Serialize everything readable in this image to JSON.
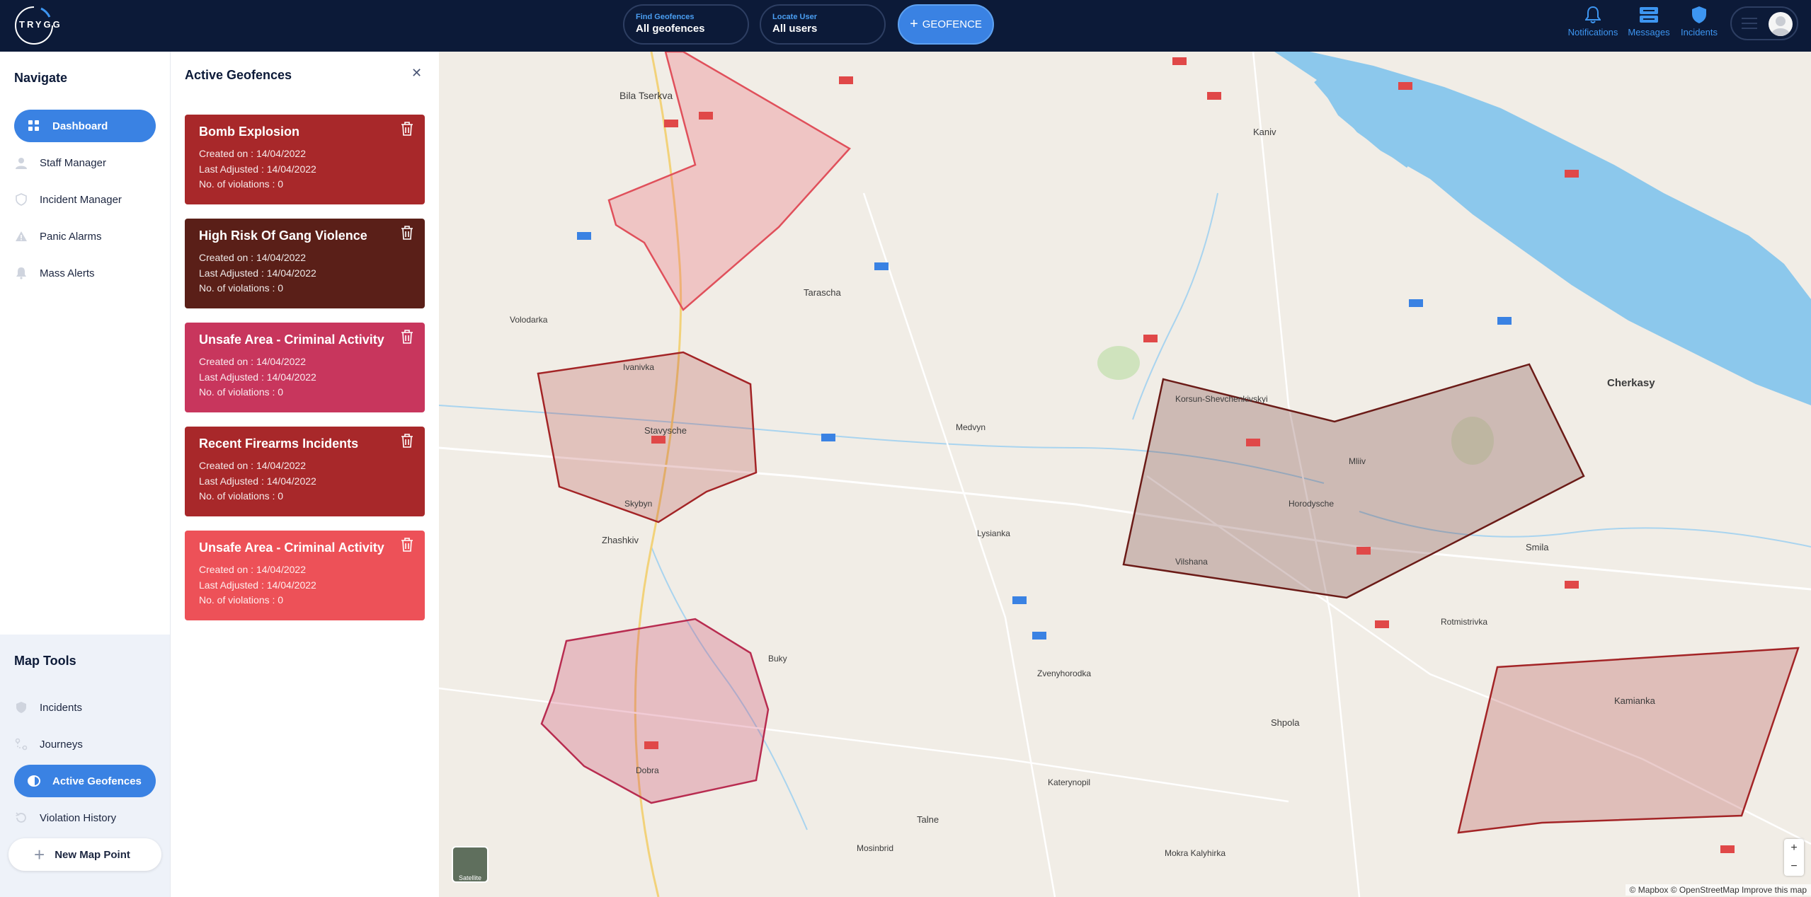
{
  "app": {
    "logo_text": "TRYGG"
  },
  "header": {
    "find_geofences": {
      "caption": "Find Geofences",
      "value": "All geofences"
    },
    "locate_user": {
      "caption": "Locate User",
      "value": "All users"
    },
    "geofence_button": "GEOFENCE",
    "notifications": "Notifications",
    "messages": "Messages",
    "incidents": "Incidents"
  },
  "navigate": {
    "title": "Navigate",
    "items": [
      {
        "label": "Dashboard",
        "icon": "grid-icon",
        "active": true
      },
      {
        "label": "Staff Manager",
        "icon": "user-icon"
      },
      {
        "label": "Incident Manager",
        "icon": "shield-icon"
      },
      {
        "label": "Panic Alarms",
        "icon": "warning-icon"
      },
      {
        "label": "Mass Alerts",
        "icon": "bell-icon"
      }
    ]
  },
  "map_tools": {
    "title": "Map Tools",
    "items": [
      {
        "label": "Incidents",
        "icon": "shield-icon"
      },
      {
        "label": "Journeys",
        "icon": "route-icon"
      },
      {
        "label": "Active Geofences",
        "icon": "geofence-icon",
        "active": true
      },
      {
        "label": "Violation History",
        "icon": "history-icon"
      }
    ],
    "new_map_point": "New Map Point"
  },
  "geofence_panel": {
    "title": "Active Geofences",
    "cards": [
      {
        "title": "Bomb Explosion",
        "created": "Created on : 14/04/2022",
        "adjusted": "Last Adjusted : 14/04/2022",
        "violations": "No. of violations : 0",
        "color": "#a8282a"
      },
      {
        "title": "High Risk Of Gang Violence",
        "created": "Created on : 14/04/2022",
        "adjusted": "Last Adjusted : 14/04/2022",
        "violations": "No. of violations : 0",
        "color": "#5a1f18"
      },
      {
        "title": "Unsafe Area - Criminal Activity",
        "created": "Created on : 14/04/2022",
        "adjusted": "Last Adjusted : 14/04/2022",
        "violations": "No. of violations : 0",
        "color": "#c8365d"
      },
      {
        "title": "Recent Firearms Incidents",
        "created": "Created on : 14/04/2022",
        "adjusted": "Last Adjusted : 14/04/2022",
        "violations": "No. of violations : 0",
        "color": "#a8282a"
      },
      {
        "title": "Unsafe Area - Criminal Activity",
        "created": "Created on : 14/04/2022",
        "adjusted": "Last Adjusted : 14/04/2022",
        "violations": "No. of violations : 0",
        "color": "#ed5158"
      }
    ]
  },
  "map": {
    "labels": [
      "Bila Tserkva",
      "Kaniv",
      "Cherkasy",
      "Stavysche",
      "Zhashkiv",
      "Tarascha",
      "Medvyn",
      "Lysianka",
      "Korsun-Shevchenkivskyi",
      "Horodysche",
      "Smila",
      "Vilshana",
      "Shpola",
      "Talne",
      "Kamianka",
      "Rotmistrivka",
      "Zvenyhorodka",
      "Buky",
      "Dobra",
      "Skybyn",
      "Volodarka",
      "Ivanivka",
      "Mliiv",
      "Katerynopil",
      "Mokra Kalyhirka",
      "Mosinbrid"
    ],
    "satellite_label": "Satellite",
    "attribution": "© Mapbox © OpenStreetMap Improve this map",
    "zoom_in": "+",
    "zoom_out": "−"
  }
}
